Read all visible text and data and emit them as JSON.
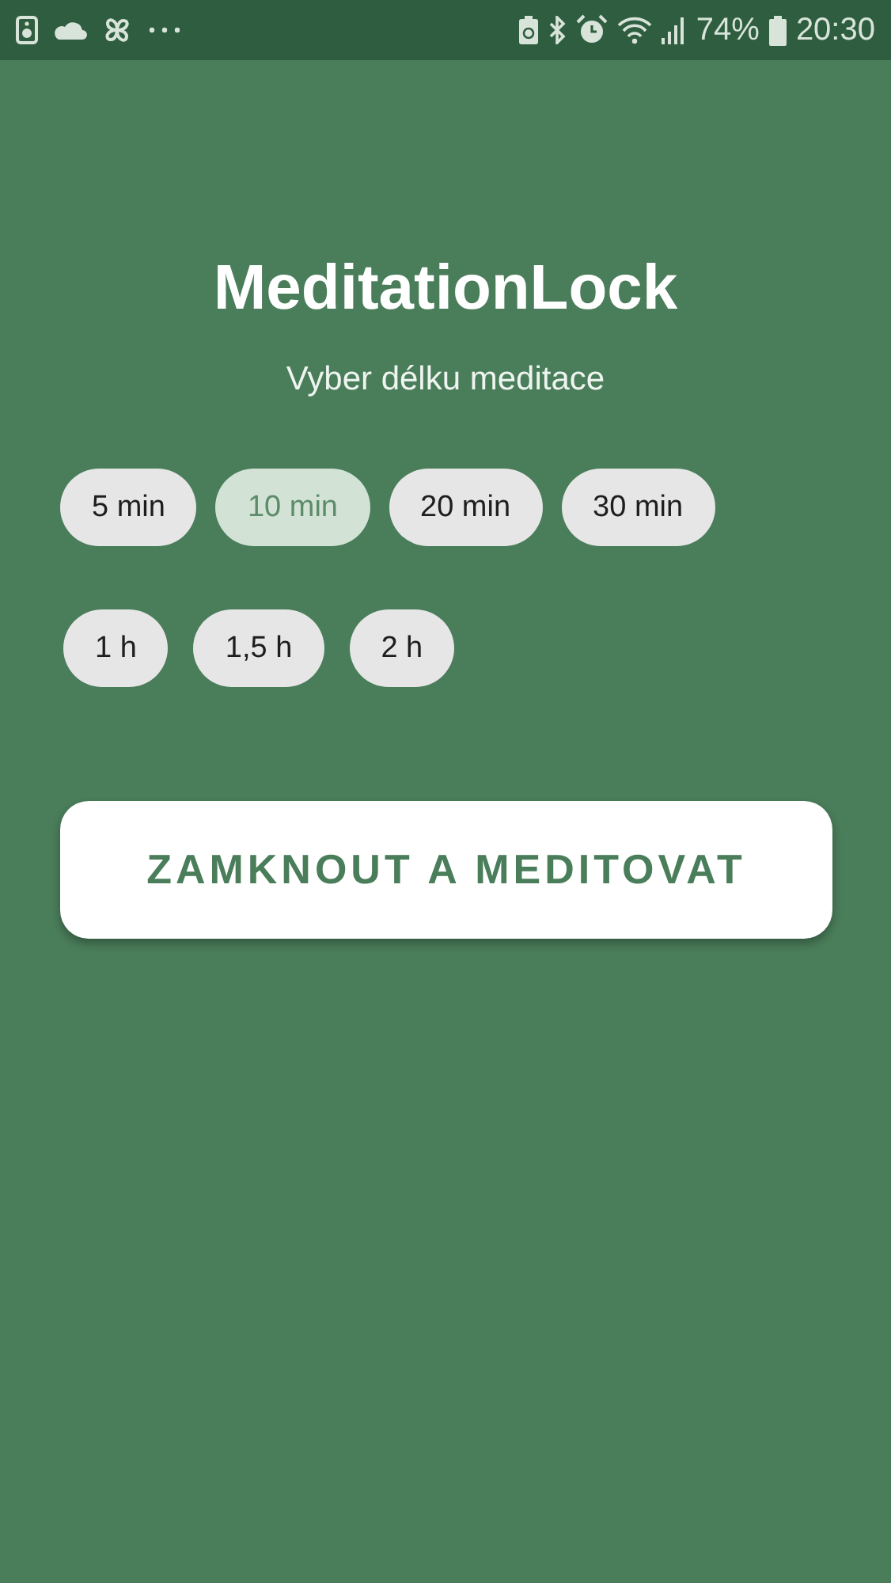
{
  "status_bar": {
    "battery": "74%",
    "time": "20:30"
  },
  "title": "MeditationLock",
  "subtitle": "Vyber délku meditace",
  "duration_rows": [
    [
      {
        "label": "5 min",
        "selected": false
      },
      {
        "label": "10 min",
        "selected": true
      },
      {
        "label": "20 min",
        "selected": false
      },
      {
        "label": "30 min",
        "selected": false
      }
    ],
    [
      {
        "label": "1 h",
        "selected": false
      },
      {
        "label": "1,5 h",
        "selected": false
      },
      {
        "label": "2 h",
        "selected": false
      }
    ]
  ],
  "lock_button": "ZAMKNOUT A MEDITOVAT"
}
